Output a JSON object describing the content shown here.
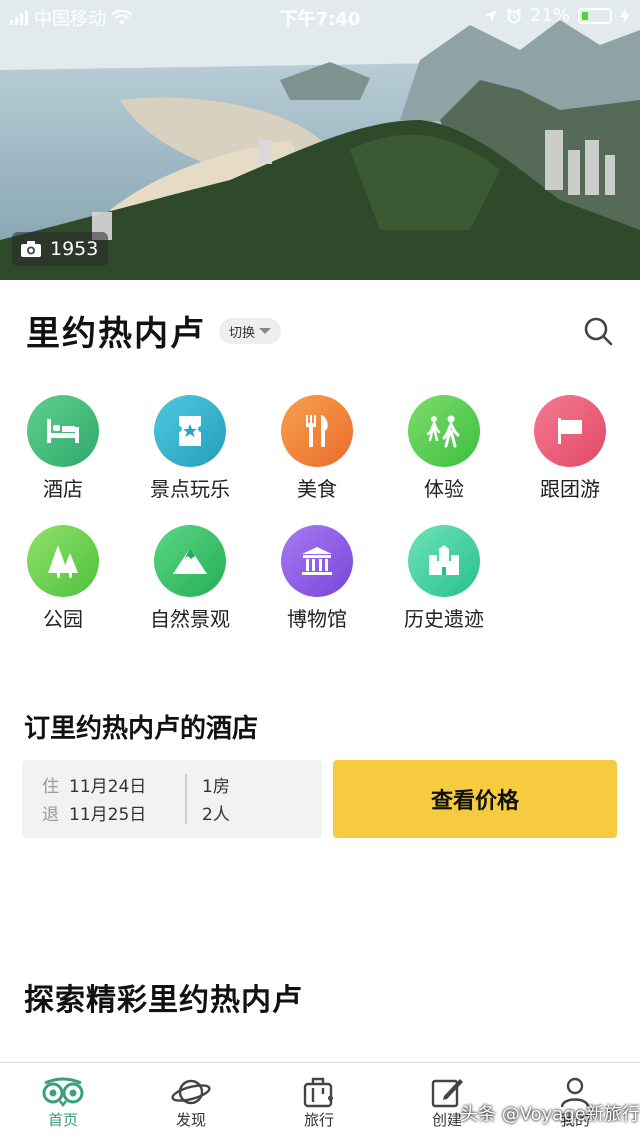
{
  "status_bar": {
    "carrier": "中国移动",
    "time": "下午7:40",
    "battery": "21%"
  },
  "hero": {
    "photo_count": "1953"
  },
  "city": {
    "name": "里约热内卢",
    "switch_label": "切换"
  },
  "categories": [
    {
      "label": "酒店",
      "icon": "bed-icon",
      "color": "#3fba7a"
    },
    {
      "label": "景点玩乐",
      "icon": "ticket-icon",
      "color": "#2eb0c9"
    },
    {
      "label": "美食",
      "icon": "fork-knife-icon",
      "color": "#f0843a"
    },
    {
      "label": "体验",
      "icon": "people-walking-icon",
      "color": "#5ccd52"
    },
    {
      "label": "跟团游",
      "icon": "flag-icon",
      "color": "#ef5e78"
    },
    {
      "label": "公园",
      "icon": "trees-icon",
      "color": "#6cd14c"
    },
    {
      "label": "自然景观",
      "icon": "mountain-icon",
      "color": "#35c267"
    },
    {
      "label": "博物馆",
      "icon": "museum-icon",
      "color": "#8e5ae8"
    },
    {
      "label": "历史遗迹",
      "icon": "castle-icon",
      "color": "#3fd3a0"
    }
  ],
  "hotel": {
    "title": "订里约热内卢的酒店",
    "checkin_label": "住",
    "checkin_date": "11月24日",
    "checkout_label": "退",
    "checkout_date": "11月25日",
    "rooms": "1房",
    "guests": "2人",
    "cta": "查看价格"
  },
  "explore": {
    "title": "探索精彩里约热内卢"
  },
  "tabs": [
    {
      "label": "首页",
      "icon": "owl-eyes-icon",
      "active": true
    },
    {
      "label": "发现",
      "icon": "planet-icon",
      "active": false
    },
    {
      "label": "旅行",
      "icon": "suitcase-icon",
      "active": false
    },
    {
      "label": "创建",
      "icon": "edit-icon",
      "active": false
    },
    {
      "label": "我的",
      "icon": "user-icon",
      "active": false
    }
  ],
  "watermark": "头条 @Voyage新旅行",
  "colors": {
    "accent": "#3b9e7e",
    "cta": "#f6cb3f"
  }
}
